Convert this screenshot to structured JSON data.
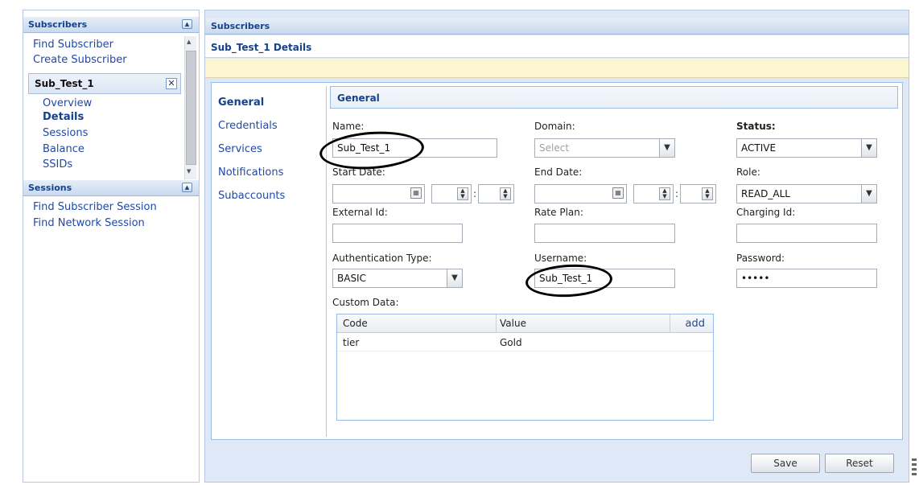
{
  "sidebar": {
    "subscribers_header": "Subscribers",
    "collapse_glyph": "▲",
    "links": [
      "Find Subscriber",
      "Create Subscriber"
    ],
    "selected_subscriber": "Sub_Test_1",
    "close_glyph": "✕",
    "sub_links": [
      "Overview",
      "Details",
      "Sessions",
      "Balance",
      "SSIDs"
    ],
    "active_sub_link": "Details",
    "sessions_header": "Sessions",
    "session_links": [
      "Find Subscriber Session",
      "Find Network Session"
    ]
  },
  "main": {
    "header": "Subscribers",
    "details_title": "Sub_Test_1 Details",
    "nav": [
      "General",
      "Credentials",
      "Services",
      "Notifications",
      "Subaccounts"
    ],
    "active_nav": "General",
    "form_header": "General"
  },
  "form": {
    "name_label": "Name:",
    "name_value": "Sub_Test_1",
    "domain_label": "Domain:",
    "domain_placeholder": "Select",
    "status_label": "Status:",
    "status_value": "ACTIVE",
    "start_date_label": "Start Date:",
    "end_date_label": "End Date:",
    "role_label": "Role:",
    "role_value": "READ_ALL",
    "external_id_label": "External Id:",
    "rate_plan_label": "Rate Plan:",
    "charging_id_label": "Charging Id:",
    "auth_type_label": "Authentication Type:",
    "auth_type_value": "BASIC",
    "username_label": "Username:",
    "username_value": "Sub_Test_1",
    "password_label": "Password:",
    "password_value": "•••••",
    "custom_data_label": "Custom Data:",
    "time_separator": ":"
  },
  "custom_data": {
    "columns": [
      "Code",
      "Value"
    ],
    "add_label": "add",
    "rows": [
      {
        "code": "tier",
        "value": "Gold"
      }
    ]
  },
  "buttons": {
    "save": "Save",
    "reset": "Reset"
  },
  "icons": {
    "dropdown": "chevron-down-icon",
    "calendar": "calendar-icon",
    "spinner": "spinner-arrows-icon",
    "collapse": "collapse-up-icon",
    "close": "close-icon"
  },
  "colors": {
    "accent": "#15428b",
    "link": "#1f49a6",
    "panel_bg": "#dfe8f6",
    "notice_bg": "#fbf6cf"
  }
}
